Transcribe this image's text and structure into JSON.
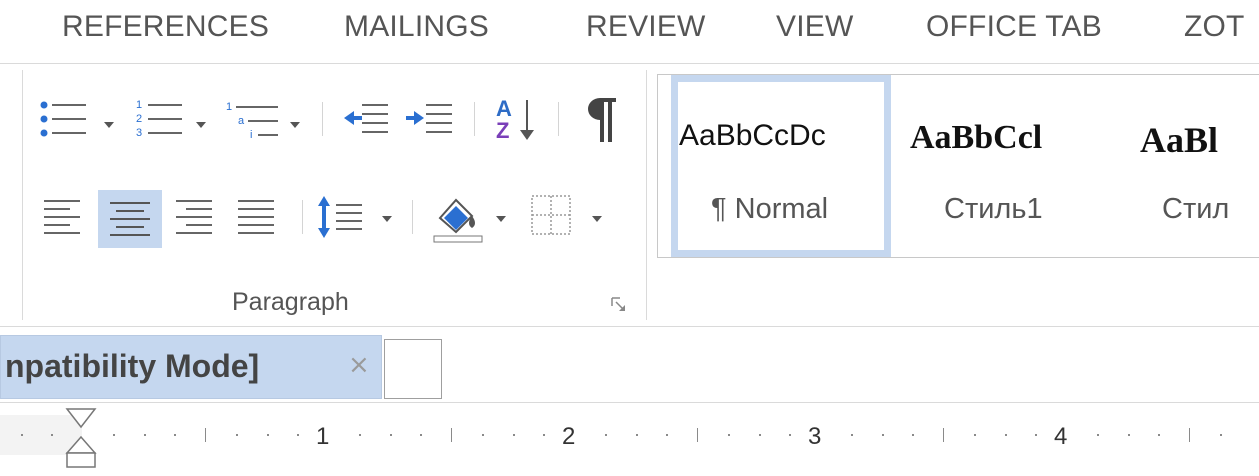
{
  "ribbon_tabs": [
    "REFERENCES",
    "MAILINGS",
    "REVIEW",
    "VIEW",
    "OFFICE TAB",
    "ZOT"
  ],
  "paragraph": {
    "group_label": "Paragraph",
    "active_alignment": "center"
  },
  "styles": [
    {
      "sample": "AaBbCcDc",
      "name": "¶ Normal",
      "selected": true
    },
    {
      "sample": "AaBbCcl",
      "name": "Стиль1",
      "selected": false
    },
    {
      "sample": "AaBl",
      "name": "Стил",
      "selected": false
    }
  ],
  "document": {
    "tab_title": "npatibility Mode]",
    "close_glyph": "×"
  },
  "ruler": {
    "numbers": [
      "1",
      "2",
      "3",
      "4"
    ]
  },
  "colors": {
    "accent_selected": "#c5d7ef",
    "az_blue": "#2e6cc6",
    "az_purple": "#7a3fb8",
    "indent_blue": "#2a6fd1"
  }
}
